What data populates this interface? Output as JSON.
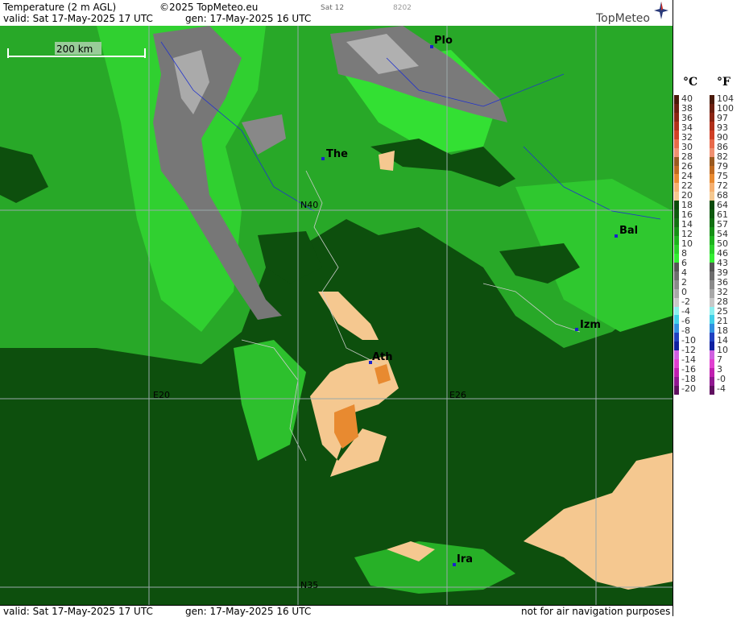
{
  "header": {
    "title": "Temperature (2 m AGL)",
    "copyright": "©2025 TopMeteo.eu",
    "day_code": "Sat 12",
    "code": "8202",
    "valid": "valid:  Sat  17-May-2025  17 UTC",
    "gen": "gen: 17-May-2025 16 UTC",
    "logo": "TopMeteo"
  },
  "footer": {
    "valid": "valid:  Sat  17-May-2025  17 UTC",
    "gen": "gen: 17-May-2025 16 UTC",
    "note": "not for air navigation purposes"
  },
  "map": {
    "scale_label": "200 km",
    "cities": [
      "Plo",
      "The",
      "Bal",
      "Izm",
      "Ath",
      "Ira"
    ],
    "grid_labels": [
      "N40",
      "N35",
      "E20",
      "E26"
    ]
  },
  "legend": {
    "unit_c": "°C",
    "unit_f": "°F",
    "celsius": [
      "40",
      "38",
      "36",
      "34",
      "32",
      "30",
      "28",
      "26",
      "24",
      "22",
      "20",
      "18",
      "16",
      "14",
      "12",
      "10",
      "8",
      "6",
      "4",
      "2",
      "0",
      "-2",
      "-4",
      "-6",
      "-8",
      "-10",
      "-12",
      "-14",
      "-16",
      "-18",
      "-20"
    ],
    "fahrenheit": [
      "104",
      "100",
      "97",
      "93",
      "90",
      "86",
      "82",
      "79",
      "75",
      "72",
      "68",
      "64",
      "61",
      "57",
      "54",
      "50",
      "46",
      "43",
      "39",
      "36",
      "32",
      "28",
      "25",
      "21",
      "18",
      "14",
      "10",
      "7",
      "3",
      "-0",
      "-4"
    ],
    "colors": [
      "#4a1a0a",
      "#6b1f10",
      "#8a2513",
      "#b0301a",
      "#d04026",
      "#e86a4a",
      "#f09070",
      "#9a5a20",
      "#c06a20",
      "#e88a30",
      "#f5b070",
      "#f5c890",
      "#0a4a0a",
      "#0e5a0e",
      "#127012",
      "#169016",
      "#1db31d",
      "#2ad02a",
      "#33ee33",
      "#555555",
      "#6e6e6e",
      "#8a8a8a",
      "#a8a8a8",
      "#c8c8c8",
      "#8cf0f0",
      "#40d0e8",
      "#3090e0",
      "#2040c0",
      "#1020a0",
      "#d060e0",
      "#e040d0",
      "#c020b0",
      "#901890",
      "#601060"
    ]
  }
}
